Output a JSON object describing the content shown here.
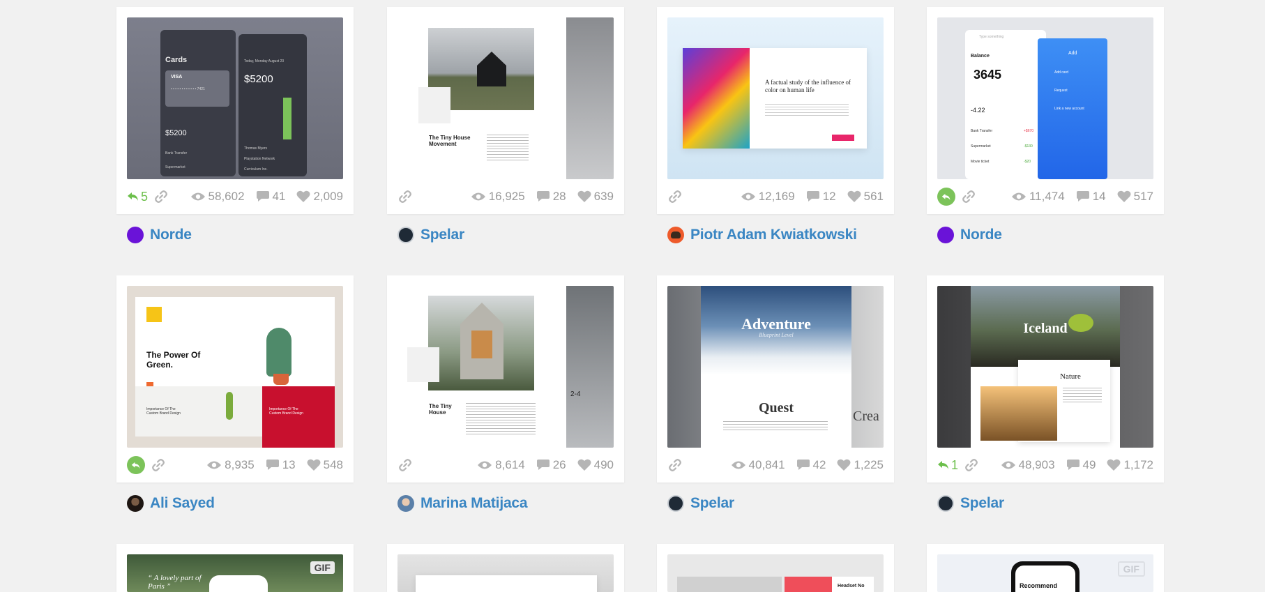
{
  "cards": [
    {
      "rebounds": "5",
      "views": "58,602",
      "comments": "41",
      "likes": "2,009",
      "author": "Norde",
      "shot_text": {
        "title": "Cards",
        "card_brand": "VISA",
        "card_number": "• • • •  • • • •  • • • •  7421",
        "amount": "$5200",
        "amount2": "$5200",
        "date": "Today, Monday August 20",
        "row1": "Bank Transfer",
        "row2": "Supermarket",
        "row3": "Thomas Myers",
        "row4": "Playstation Network",
        "row5": "Curriculum Inc."
      }
    },
    {
      "views": "16,925",
      "comments": "28",
      "likes": "639",
      "author": "Spelar",
      "shot_text": {
        "heading": "The Tiny House Movement"
      }
    },
    {
      "views": "12,169",
      "comments": "12",
      "likes": "561",
      "author": "Piotr Adam Kwiatkowski",
      "shot_text": {
        "heading": "A factual study of the influence of color on human life"
      }
    },
    {
      "rebounds": "",
      "views": "11,474",
      "comments": "14",
      "likes": "517",
      "author": "Norde",
      "shot_text": {
        "balance_label": "Balance",
        "balance": "3645",
        "add": "Add",
        "add_card": "Add card",
        "request": "Request",
        "link_account": "Link a new account",
        "stock": "-4.22",
        "row1": "Bank Transfer",
        "row2": "Supermarket",
        "row3": "Movie ticket",
        "v1": "+$670",
        "v2": "-$130",
        "v3": "-$20",
        "search": "Type something"
      }
    },
    {
      "rebounds": "",
      "views": "8,935",
      "comments": "13",
      "likes": "548",
      "author": "Ali Sayed",
      "shot_text": {
        "heading": "The Power Of Green.",
        "sub1": "Importance Of The Custom Brand Design",
        "sub2": "Importance Of The Custom Brand Design"
      }
    },
    {
      "views": "8,614",
      "comments": "26",
      "likes": "490",
      "author": "Marina Matijaca",
      "shot_text": {
        "heading": "The Tiny House",
        "side": "2-4"
      }
    },
    {
      "views": "40,841",
      "comments": "42",
      "likes": "1,225",
      "author": "Spelar",
      "shot_text": {
        "heading": "Adventure",
        "script": "Blueprint Level",
        "sub": "Quest",
        "side": "Crea"
      }
    },
    {
      "rebounds": "1",
      "views": "48,903",
      "comments": "49",
      "likes": "1,172",
      "author": "Spelar",
      "shot_text": {
        "heading": "Iceland",
        "sub": "Nature"
      }
    },
    {
      "gif": "GIF",
      "shot_text": {
        "quote": "“ A lovely part of Paris ”"
      }
    },
    {
      "shot_text": {}
    },
    {
      "shot_text": {
        "headline": "Headset No"
      }
    },
    {
      "gif": "GIF",
      "shot_text": {
        "recommend": "Recommend"
      }
    }
  ],
  "colors": {
    "link": "#3a86c3",
    "stat": "#9a9a9a",
    "rebound": "#6cbf4b",
    "background": "#f1f1f1"
  }
}
